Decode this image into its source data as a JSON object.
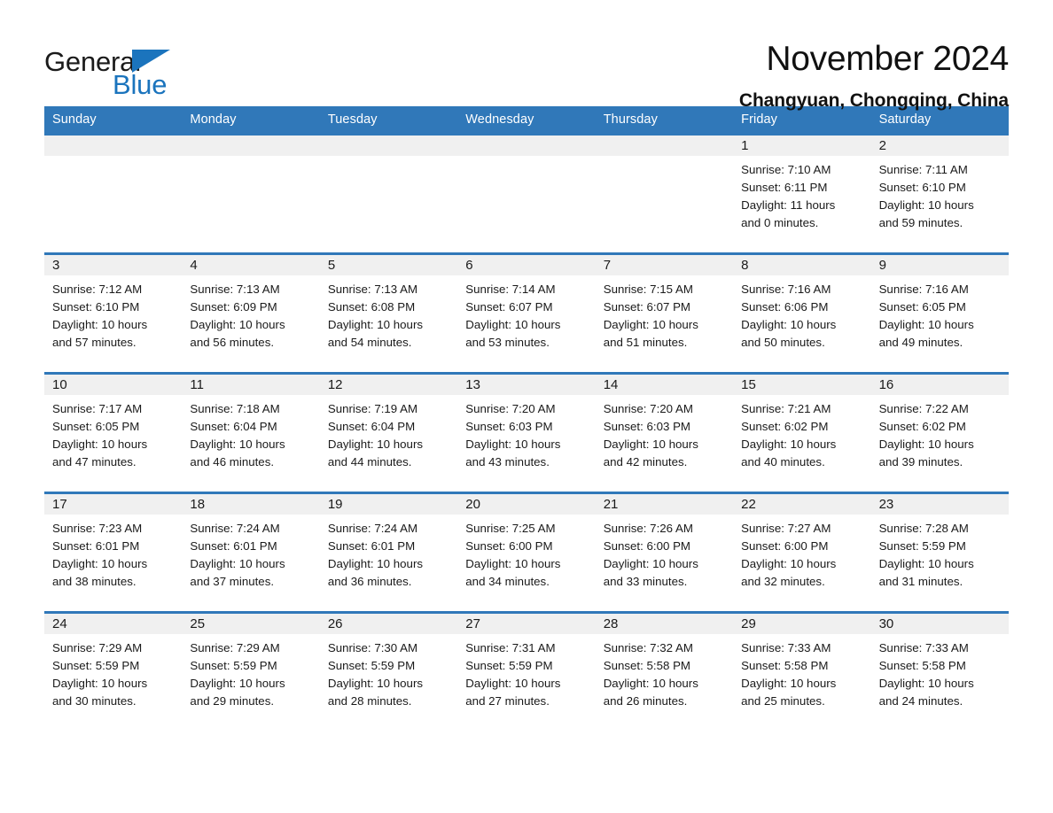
{
  "brand": {
    "name_part1": "General",
    "name_part2": "Blue",
    "accent_color": "#1b74bd"
  },
  "header": {
    "title": "November 2024",
    "location": "Changyuan, Chongqing, China"
  },
  "theme": {
    "header_bar_color": "#3078b9",
    "day_band_color": "#f0f0f0",
    "text_color": "#1a1a1a"
  },
  "weekdays": [
    "Sunday",
    "Monday",
    "Tuesday",
    "Wednesday",
    "Thursday",
    "Friday",
    "Saturday"
  ],
  "weeks": [
    [
      {
        "day": "",
        "sunrise": "",
        "sunset": "",
        "daylight_line1": "",
        "daylight_line2": ""
      },
      {
        "day": "",
        "sunrise": "",
        "sunset": "",
        "daylight_line1": "",
        "daylight_line2": ""
      },
      {
        "day": "",
        "sunrise": "",
        "sunset": "",
        "daylight_line1": "",
        "daylight_line2": ""
      },
      {
        "day": "",
        "sunrise": "",
        "sunset": "",
        "daylight_line1": "",
        "daylight_line2": ""
      },
      {
        "day": "",
        "sunrise": "",
        "sunset": "",
        "daylight_line1": "",
        "daylight_line2": ""
      },
      {
        "day": "1",
        "sunrise": "Sunrise: 7:10 AM",
        "sunset": "Sunset: 6:11 PM",
        "daylight_line1": "Daylight: 11 hours",
        "daylight_line2": "and 0 minutes."
      },
      {
        "day": "2",
        "sunrise": "Sunrise: 7:11 AM",
        "sunset": "Sunset: 6:10 PM",
        "daylight_line1": "Daylight: 10 hours",
        "daylight_line2": "and 59 minutes."
      }
    ],
    [
      {
        "day": "3",
        "sunrise": "Sunrise: 7:12 AM",
        "sunset": "Sunset: 6:10 PM",
        "daylight_line1": "Daylight: 10 hours",
        "daylight_line2": "and 57 minutes."
      },
      {
        "day": "4",
        "sunrise": "Sunrise: 7:13 AM",
        "sunset": "Sunset: 6:09 PM",
        "daylight_line1": "Daylight: 10 hours",
        "daylight_line2": "and 56 minutes."
      },
      {
        "day": "5",
        "sunrise": "Sunrise: 7:13 AM",
        "sunset": "Sunset: 6:08 PM",
        "daylight_line1": "Daylight: 10 hours",
        "daylight_line2": "and 54 minutes."
      },
      {
        "day": "6",
        "sunrise": "Sunrise: 7:14 AM",
        "sunset": "Sunset: 6:07 PM",
        "daylight_line1": "Daylight: 10 hours",
        "daylight_line2": "and 53 minutes."
      },
      {
        "day": "7",
        "sunrise": "Sunrise: 7:15 AM",
        "sunset": "Sunset: 6:07 PM",
        "daylight_line1": "Daylight: 10 hours",
        "daylight_line2": "and 51 minutes."
      },
      {
        "day": "8",
        "sunrise": "Sunrise: 7:16 AM",
        "sunset": "Sunset: 6:06 PM",
        "daylight_line1": "Daylight: 10 hours",
        "daylight_line2": "and 50 minutes."
      },
      {
        "day": "9",
        "sunrise": "Sunrise: 7:16 AM",
        "sunset": "Sunset: 6:05 PM",
        "daylight_line1": "Daylight: 10 hours",
        "daylight_line2": "and 49 minutes."
      }
    ],
    [
      {
        "day": "10",
        "sunrise": "Sunrise: 7:17 AM",
        "sunset": "Sunset: 6:05 PM",
        "daylight_line1": "Daylight: 10 hours",
        "daylight_line2": "and 47 minutes."
      },
      {
        "day": "11",
        "sunrise": "Sunrise: 7:18 AM",
        "sunset": "Sunset: 6:04 PM",
        "daylight_line1": "Daylight: 10 hours",
        "daylight_line2": "and 46 minutes."
      },
      {
        "day": "12",
        "sunrise": "Sunrise: 7:19 AM",
        "sunset": "Sunset: 6:04 PM",
        "daylight_line1": "Daylight: 10 hours",
        "daylight_line2": "and 44 minutes."
      },
      {
        "day": "13",
        "sunrise": "Sunrise: 7:20 AM",
        "sunset": "Sunset: 6:03 PM",
        "daylight_line1": "Daylight: 10 hours",
        "daylight_line2": "and 43 minutes."
      },
      {
        "day": "14",
        "sunrise": "Sunrise: 7:20 AM",
        "sunset": "Sunset: 6:03 PM",
        "daylight_line1": "Daylight: 10 hours",
        "daylight_line2": "and 42 minutes."
      },
      {
        "day": "15",
        "sunrise": "Sunrise: 7:21 AM",
        "sunset": "Sunset: 6:02 PM",
        "daylight_line1": "Daylight: 10 hours",
        "daylight_line2": "and 40 minutes."
      },
      {
        "day": "16",
        "sunrise": "Sunrise: 7:22 AM",
        "sunset": "Sunset: 6:02 PM",
        "daylight_line1": "Daylight: 10 hours",
        "daylight_line2": "and 39 minutes."
      }
    ],
    [
      {
        "day": "17",
        "sunrise": "Sunrise: 7:23 AM",
        "sunset": "Sunset: 6:01 PM",
        "daylight_line1": "Daylight: 10 hours",
        "daylight_line2": "and 38 minutes."
      },
      {
        "day": "18",
        "sunrise": "Sunrise: 7:24 AM",
        "sunset": "Sunset: 6:01 PM",
        "daylight_line1": "Daylight: 10 hours",
        "daylight_line2": "and 37 minutes."
      },
      {
        "day": "19",
        "sunrise": "Sunrise: 7:24 AM",
        "sunset": "Sunset: 6:01 PM",
        "daylight_line1": "Daylight: 10 hours",
        "daylight_line2": "and 36 minutes."
      },
      {
        "day": "20",
        "sunrise": "Sunrise: 7:25 AM",
        "sunset": "Sunset: 6:00 PM",
        "daylight_line1": "Daylight: 10 hours",
        "daylight_line2": "and 34 minutes."
      },
      {
        "day": "21",
        "sunrise": "Sunrise: 7:26 AM",
        "sunset": "Sunset: 6:00 PM",
        "daylight_line1": "Daylight: 10 hours",
        "daylight_line2": "and 33 minutes."
      },
      {
        "day": "22",
        "sunrise": "Sunrise: 7:27 AM",
        "sunset": "Sunset: 6:00 PM",
        "daylight_line1": "Daylight: 10 hours",
        "daylight_line2": "and 32 minutes."
      },
      {
        "day": "23",
        "sunrise": "Sunrise: 7:28 AM",
        "sunset": "Sunset: 5:59 PM",
        "daylight_line1": "Daylight: 10 hours",
        "daylight_line2": "and 31 minutes."
      }
    ],
    [
      {
        "day": "24",
        "sunrise": "Sunrise: 7:29 AM",
        "sunset": "Sunset: 5:59 PM",
        "daylight_line1": "Daylight: 10 hours",
        "daylight_line2": "and 30 minutes."
      },
      {
        "day": "25",
        "sunrise": "Sunrise: 7:29 AM",
        "sunset": "Sunset: 5:59 PM",
        "daylight_line1": "Daylight: 10 hours",
        "daylight_line2": "and 29 minutes."
      },
      {
        "day": "26",
        "sunrise": "Sunrise: 7:30 AM",
        "sunset": "Sunset: 5:59 PM",
        "daylight_line1": "Daylight: 10 hours",
        "daylight_line2": "and 28 minutes."
      },
      {
        "day": "27",
        "sunrise": "Sunrise: 7:31 AM",
        "sunset": "Sunset: 5:59 PM",
        "daylight_line1": "Daylight: 10 hours",
        "daylight_line2": "and 27 minutes."
      },
      {
        "day": "28",
        "sunrise": "Sunrise: 7:32 AM",
        "sunset": "Sunset: 5:58 PM",
        "daylight_line1": "Daylight: 10 hours",
        "daylight_line2": "and 26 minutes."
      },
      {
        "day": "29",
        "sunrise": "Sunrise: 7:33 AM",
        "sunset": "Sunset: 5:58 PM",
        "daylight_line1": "Daylight: 10 hours",
        "daylight_line2": "and 25 minutes."
      },
      {
        "day": "30",
        "sunrise": "Sunrise: 7:33 AM",
        "sunset": "Sunset: 5:58 PM",
        "daylight_line1": "Daylight: 10 hours",
        "daylight_line2": "and 24 minutes."
      }
    ]
  ]
}
